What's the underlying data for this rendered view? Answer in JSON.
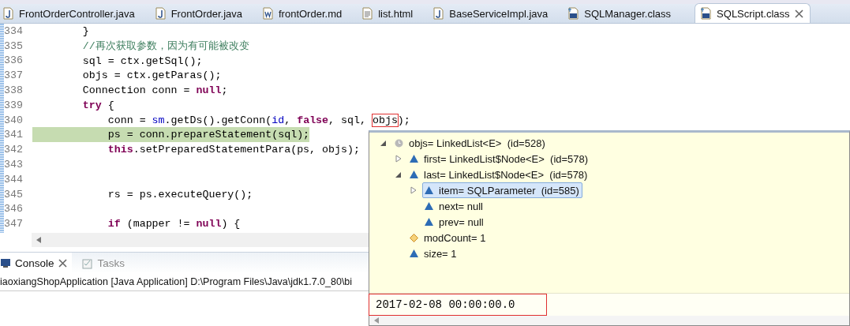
{
  "editor_tabs": [
    {
      "label": "FrontOrderController.java",
      "kind": "java",
      "selected": false
    },
    {
      "label": "FrontOrder.java",
      "kind": "java",
      "selected": false
    },
    {
      "label": "frontOrder.md",
      "kind": "word",
      "selected": false
    },
    {
      "label": "list.html",
      "kind": "html",
      "selected": false
    },
    {
      "label": "BaseServiceImpl.java",
      "kind": "java",
      "selected": false
    },
    {
      "label": "SQLManager.class",
      "kind": "class",
      "selected": false
    },
    {
      "label": "SQLScript.class",
      "kind": "class",
      "selected": true
    }
  ],
  "code_lines": [
    {
      "number": "334",
      "current": false,
      "tokens": [
        {
          "text": "        }",
          "kind": "plain"
        }
      ]
    },
    {
      "number": "335",
      "current": false,
      "tokens": [
        {
          "text": "        //再次获取参数，因为有可能被改变",
          "kind": "comment"
        }
      ]
    },
    {
      "number": "336",
      "current": false,
      "tokens": [
        {
          "text": "        sql = ctx.getSql();",
          "kind": "plain"
        }
      ]
    },
    {
      "number": "337",
      "current": false,
      "tokens": [
        {
          "text": "        objs = ctx.getParas();",
          "kind": "plain"
        }
      ]
    },
    {
      "number": "338",
      "current": false,
      "tokens": [
        {
          "text": "        Connection conn = ",
          "kind": "plain"
        },
        {
          "text": "null",
          "kind": "keyword"
        },
        {
          "text": ";",
          "kind": "plain"
        }
      ]
    },
    {
      "number": "339",
      "current": false,
      "tokens": [
        {
          "text": "        try",
          "kind": "keyword"
        },
        {
          "text": " {",
          "kind": "plain"
        }
      ]
    },
    {
      "number": "340",
      "current": false,
      "tokens": [
        {
          "text": "            conn = ",
          "kind": "plain"
        },
        {
          "text": "sm",
          "kind": "field"
        },
        {
          "text": ".getDs().getConn(",
          "kind": "plain"
        },
        {
          "text": "id",
          "kind": "field"
        },
        {
          "text": ", ",
          "kind": "plain"
        },
        {
          "text": "false",
          "kind": "keyword"
        },
        {
          "text": ", sql, ",
          "kind": "plain"
        },
        {
          "text": "objs",
          "kind": "plain",
          "outlined": true
        },
        {
          "text": ");",
          "kind": "plain"
        }
      ]
    },
    {
      "number": "341",
      "current": true,
      "tokens": [
        {
          "text": "            ps = conn.prepareStatement(sql);",
          "kind": "plain"
        }
      ]
    },
    {
      "number": "342",
      "current": false,
      "tokens": [
        {
          "text": "            this",
          "kind": "keyword"
        },
        {
          "text": ".setPreparedStatementPara(ps, objs);",
          "kind": "plain"
        }
      ]
    },
    {
      "number": "343",
      "current": false
    },
    {
      "number": "344",
      "current": false
    },
    {
      "number": "345",
      "current": false,
      "tokens": [
        {
          "text": "            rs = ps.executeQuery();",
          "kind": "plain"
        }
      ]
    },
    {
      "number": "346",
      "current": false
    },
    {
      "number": "347",
      "current": false,
      "tokens": [
        {
          "text": "            if",
          "kind": "keyword"
        },
        {
          "text": " (mapper != ",
          "kind": "plain"
        },
        {
          "text": "null",
          "kind": "keyword"
        },
        {
          "text": ") {",
          "kind": "plain"
        }
      ]
    }
  ],
  "console_tabs": [
    {
      "label": "Console",
      "kind": "console",
      "selected": true
    },
    {
      "label": "Tasks",
      "kind": "tasks",
      "selected": false
    }
  ],
  "console_line": "iaoxiangShopApplication [Java Application] D:\\Program Files\\Java\\jdk1.7.0_80\\bi",
  "inspect_popup": {
    "tree": [
      {
        "label": "objs= LinkedList<E>  (id=528)",
        "kind": "static",
        "expanded": true,
        "selected": false,
        "children": [
          {
            "label": "first= LinkedList$Node<E>  (id=578)",
            "kind": "field",
            "expanded": false,
            "selected": false
          },
          {
            "label": "last= LinkedList$Node<E>  (id=578)",
            "kind": "field",
            "expanded": true,
            "selected": false,
            "children": [
              {
                "label": "item= SQLParameter  (id=585)",
                "kind": "field",
                "expanded": false,
                "selected": true
              },
              {
                "label": "next= null",
                "kind": "field",
                "selected": false
              },
              {
                "label": "prev= null",
                "kind": "field",
                "selected": false
              }
            ]
          },
          {
            "label": "modCount= 1",
            "kind": "protected",
            "selected": false
          },
          {
            "label": "size= 1",
            "kind": "field",
            "selected": false
          }
        ]
      }
    ],
    "detail": {
      "text": "2017-02-08 00:00:00.0",
      "outlined": true
    }
  }
}
